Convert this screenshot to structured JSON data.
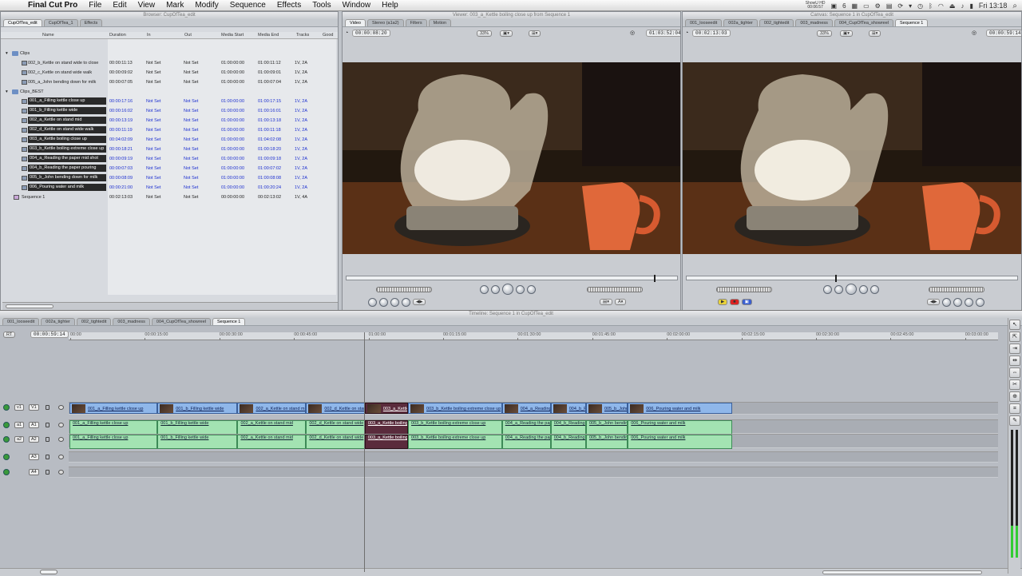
{
  "menubar": {
    "app": "Final Cut Pro",
    "items": [
      "File",
      "Edit",
      "View",
      "Mark",
      "Modify",
      "Sequence",
      "Effects",
      "Tools",
      "Window",
      "Help"
    ],
    "clock": "Fri 13:18",
    "show_hd": "ShowU HD",
    "show_hd_time": "00:06:57",
    "battery_num": "6"
  },
  "browser": {
    "title": "Browser: CupOfTea_edit",
    "tabs": [
      "CupOfTea_edit",
      "CupOfTea_1",
      "Effects"
    ],
    "columns": [
      "Name",
      "Duration",
      "In",
      "Out",
      "Media Start",
      "Media End",
      "Tracks",
      "Good"
    ],
    "rows": [
      {
        "type": "bin",
        "name": "Clips",
        "duration": "",
        "in": "",
        "out": "",
        "mstart": "",
        "mend": "",
        "tracks": ""
      },
      {
        "type": "clip",
        "name": "002_b_Kettle on stand wide to close",
        "duration": "00:00:11:13",
        "in": "Not Set",
        "out": "Not Set",
        "mstart": "01:00:00:00",
        "mend": "01:00:11:12",
        "tracks": "1V, 2A"
      },
      {
        "type": "clip",
        "name": "002_c_Kettle on stand wide walk",
        "duration": "00:00:09:02",
        "in": "Not Set",
        "out": "Not Set",
        "mstart": "01:00:00:00",
        "mend": "01:00:09:01",
        "tracks": "1V, 2A"
      },
      {
        "type": "clip",
        "name": "005_a_John bending down for milk",
        "duration": "00:00:07:05",
        "in": "Not Set",
        "out": "Not Set",
        "mstart": "01:00:00:00",
        "mend": "01:00:07:04",
        "tracks": "1V, 2A"
      },
      {
        "type": "bin",
        "name": "Clips_BEST",
        "duration": "",
        "in": "",
        "out": "",
        "mstart": "",
        "mend": "",
        "tracks": ""
      },
      {
        "type": "sel",
        "name": "001_a_Filling kettle close up",
        "duration": "00:00:17:16",
        "in": "Not Set",
        "out": "Not Set",
        "mstart": "01:00:00:00",
        "mend": "01:00:17:15",
        "tracks": "1V, 2A"
      },
      {
        "type": "sel",
        "name": "001_b_Filling kettle wide",
        "duration": "00:00:16:02",
        "in": "Not Set",
        "out": "Not Set",
        "mstart": "01:00:00:00",
        "mend": "01:00:16:01",
        "tracks": "1V, 2A"
      },
      {
        "type": "sel",
        "name": "002_a_Kettle on stand mid",
        "duration": "00:00:13:19",
        "in": "Not Set",
        "out": "Not Set",
        "mstart": "01:00:00:00",
        "mend": "01:00:13:18",
        "tracks": "1V, 2A"
      },
      {
        "type": "sel",
        "name": "002_d_Kettle on stand wide walk",
        "duration": "00:00:11:19",
        "in": "Not Set",
        "out": "Not Set",
        "mstart": "01:00:00:00",
        "mend": "01:00:11:18",
        "tracks": "1V, 2A"
      },
      {
        "type": "sel",
        "name": "003_a_Kettle boiling close up",
        "duration": "00:04:02:09",
        "in": "Not Set",
        "out": "Not Set",
        "mstart": "01:00:00:00",
        "mend": "01:04:02:08",
        "tracks": "1V, 2A"
      },
      {
        "type": "sel",
        "name": "003_b_Kettle boiling extreme close up",
        "duration": "00:00:18:21",
        "in": "Not Set",
        "out": "Not Set",
        "mstart": "01:00:00:00",
        "mend": "01:00:18:20",
        "tracks": "1V, 2A"
      },
      {
        "type": "sel",
        "name": "004_a_Reading the paper mid shot",
        "duration": "00:00:09:19",
        "in": "Not Set",
        "out": "Not Set",
        "mstart": "01:00:00:00",
        "mend": "01:00:09:18",
        "tracks": "1V, 2A"
      },
      {
        "type": "sel",
        "name": "004_b_Reading the paper pouring",
        "duration": "00:00:07:03",
        "in": "Not Set",
        "out": "Not Set",
        "mstart": "01:00:00:00",
        "mend": "01:00:07:02",
        "tracks": "1V, 2A"
      },
      {
        "type": "sel",
        "name": "005_b_John bending down for milk",
        "duration": "00:00:08:09",
        "in": "Not Set",
        "out": "Not Set",
        "mstart": "01:00:00:00",
        "mend": "01:00:08:08",
        "tracks": "1V, 2A"
      },
      {
        "type": "sel",
        "name": "006_Pouring water and milk",
        "duration": "00:00:21:00",
        "in": "Not Set",
        "out": "Not Set",
        "mstart": "01:00:00:00",
        "mend": "01:00:20:24",
        "tracks": "1V, 2A"
      },
      {
        "type": "seq",
        "name": "Sequence 1",
        "duration": "00:02:13:03",
        "in": "Not Set",
        "out": "Not Set",
        "mstart": "00:00:00:00",
        "mend": "00:02:13:02",
        "tracks": "1V, 4A"
      }
    ]
  },
  "viewer": {
    "title": "Viewer: 003_a_Kettle boiling close up from Sequence 1",
    "tabs": [
      "Video",
      "Stereo (a1a2)",
      "Filters",
      "Motion"
    ],
    "timecode_left": "00:00:08:20",
    "zoom": "33%",
    "timecode_right": "01:03:52:04",
    "playhead_fraction": 0.93
  },
  "canvas": {
    "title": "Canvas: Sequence 1 in CupOfTea_edit",
    "tabs": [
      "001_looseedit",
      "002a_tighter",
      "002_tightedit",
      "003_madness",
      "004_CupOfTea_showreel",
      "Sequence 1"
    ],
    "timecode_left": "00:02:13:03",
    "zoom": "33%",
    "timecode_right": "00:00:59:14",
    "playhead_fraction": 0.45
  },
  "timeline": {
    "title": "Timeline: Sequence 1 in CupOfTea_edit",
    "tabs": [
      "001_looseedit",
      "002a_tighter",
      "002_tightedit",
      "003_madness",
      "004_CupOfTea_showreel",
      "Sequence 1"
    ],
    "rt_label": "RT",
    "timecode": "00:00:59:14",
    "ruler": [
      "00:00",
      "00:00:15:00",
      "00:00:30:00",
      "00:00:45:00",
      "01:00:00",
      "00:01:15:00",
      "00:01:30:00",
      "00:01:45:00",
      "00:02:00:00",
      "00:02:15:00",
      "00:02:30:00",
      "00:02:45:00",
      "00:03:00:00"
    ],
    "tracks": [
      {
        "src": "v1",
        "dst": "V1"
      },
      {
        "src": "a1",
        "dst": "A1"
      },
      {
        "src": "a2",
        "dst": "A2"
      },
      {
        "src": "",
        "dst": "A3"
      },
      {
        "src": "",
        "dst": "A4"
      }
    ],
    "video_clips": [
      {
        "name": "001_a_Filling kettle close up",
        "start": 0.0,
        "dur": 17.7
      },
      {
        "name": "001_b_Filling kettle wide",
        "start": 17.7,
        "dur": 16.1
      },
      {
        "name": "002_a_Kettle on stand mid",
        "start": 33.8,
        "dur": 13.8
      },
      {
        "name": "002_d_Kettle on stand wide",
        "start": 47.6,
        "dur": 11.8
      },
      {
        "name": "003_a_Kettle boiling close up",
        "start": 59.4,
        "dur": 8.7,
        "selected": true
      },
      {
        "name": "003_b_Kettle boiling extreme close up",
        "start": 68.1,
        "dur": 18.9
      },
      {
        "name": "004_a_Reading the paper",
        "start": 87.0,
        "dur": 9.8
      },
      {
        "name": "004_b_Reading the paper",
        "start": 96.8,
        "dur": 7.1
      },
      {
        "name": "005_b_John bending down",
        "start": 103.9,
        "dur": 8.4
      },
      {
        "name": "006_Pouring water and milk",
        "start": 112.3,
        "dur": 21.0
      }
    ],
    "seconds_per_ruler_step": 15
  }
}
